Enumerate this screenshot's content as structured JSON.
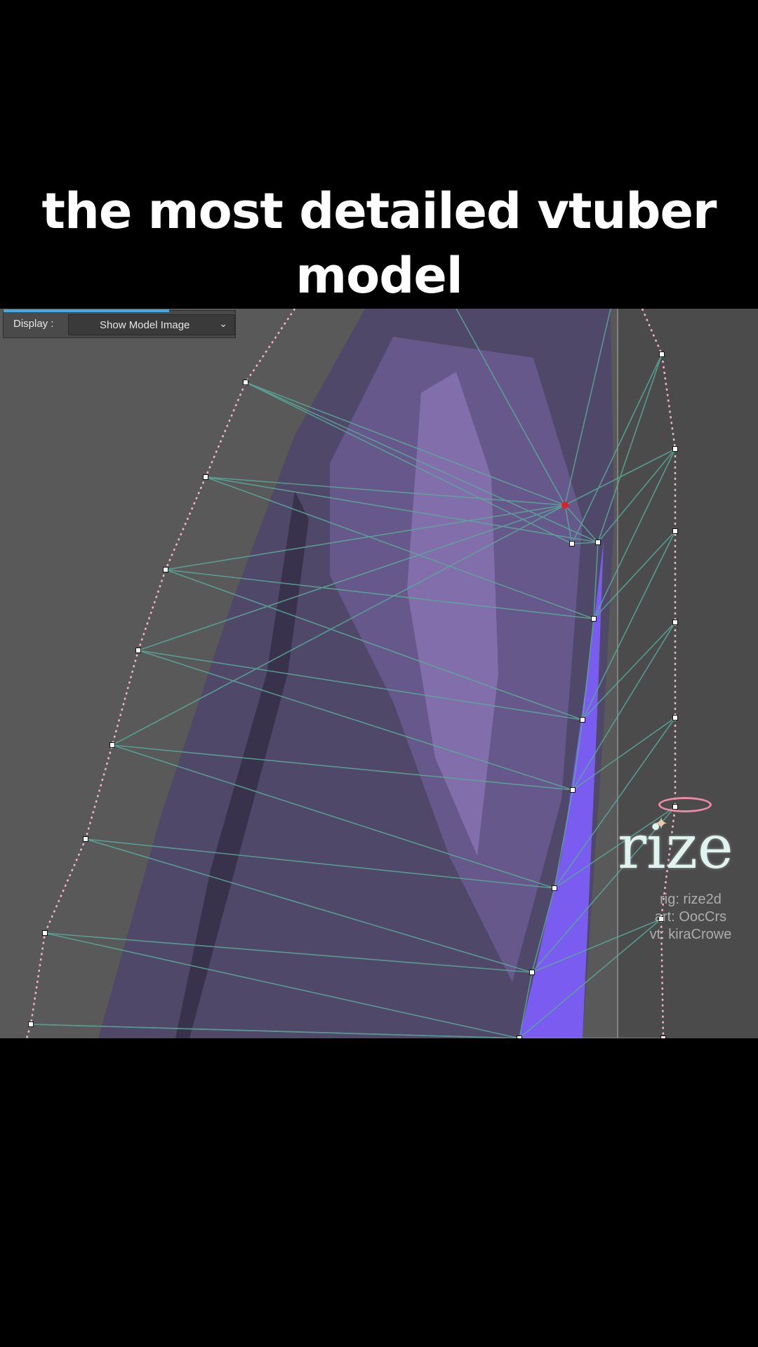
{
  "caption": {
    "line1": "the most detailed vtuber",
    "line2": "model"
  },
  "editor": {
    "display_label": "Display :",
    "display_value": "Show Model Image",
    "chevron_icon": "chevron-down-icon",
    "colors": {
      "canvas": "#595959",
      "mesh_edge": "#5aa89a",
      "outline": "#f1b5c4",
      "hair_dark": "#4f4868",
      "hair_light": "#8c73b8",
      "highlight": "#7b5cf0",
      "selected_vertex": "#e0202a"
    }
  },
  "watermark": {
    "logo": "rize",
    "credits": [
      "rig: rize2d",
      "art: OocCrs",
      "vt: kiraCrowe"
    ]
  }
}
